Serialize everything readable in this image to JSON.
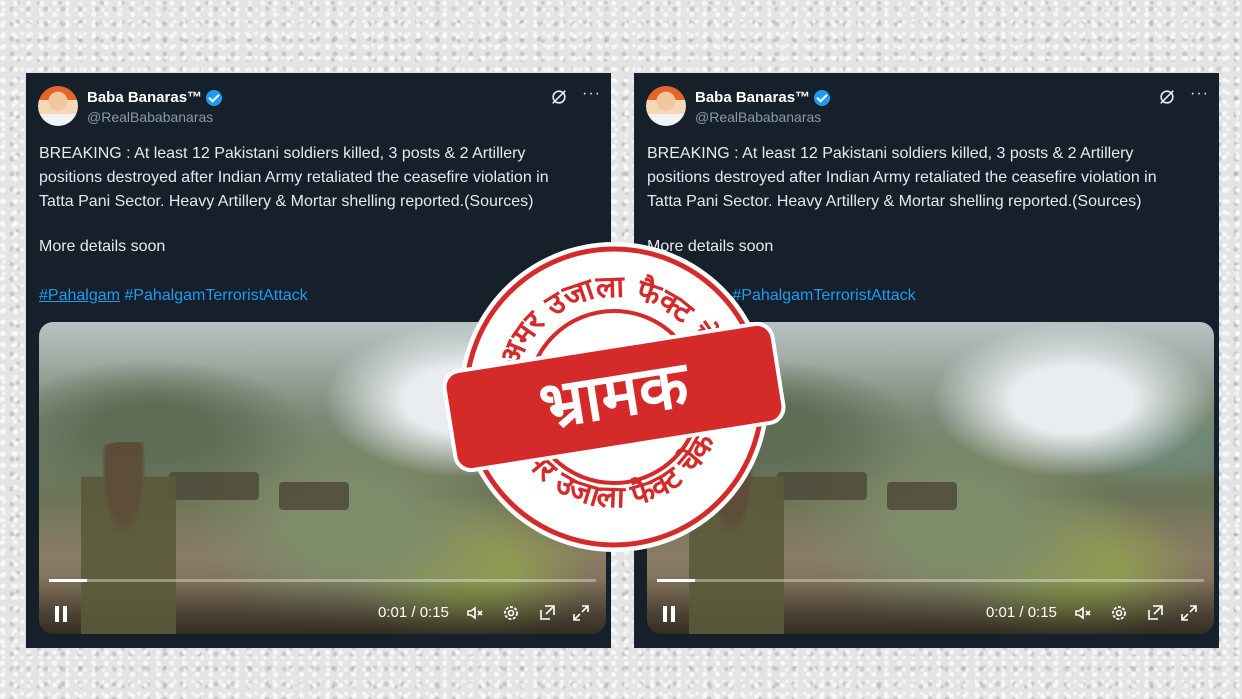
{
  "tweets": [
    {
      "author": "Baba Banaras™",
      "handle": "@RealBababanaras",
      "text": "BREAKING : At least 12 Pakistani soldiers killed, 3 posts & 2 Artillery\npositions destroyed after Indian Army retaliated the ceasefire violation in\nTatta Pani Sector. Heavy Artillery & Mortar shelling reported.(Sources)",
      "more": "More details soon",
      "hashtags": [
        "#Pahalgam",
        "#PahalgamTerroristAttack"
      ],
      "video": {
        "time": "0:01 / 0:15",
        "progress": 0.07
      }
    },
    {
      "author": "Baba Banaras™",
      "handle": "@RealBababanaras",
      "text": "BREAKING : At least 12 Pakistani soldiers killed, 3 posts & 2 Artillery\npositions destroyed after Indian Army retaliated the ceasefire violation in\nTatta Pani Sector. Heavy Artillery & Mortar shelling reported.(Sources)",
      "more": "More details soon",
      "hashtags": [
        "#Pahalgam",
        "#PahalgamTerroristAttack"
      ],
      "video": {
        "time": "0:01 / 0:15",
        "progress": 0.07
      }
    }
  ],
  "stamp": {
    "label": "भ्रामक",
    "ring_text_top": "अमर उजाला फैक्ट चेक",
    "ring_text_bottom": "अमर उजाला फैक्ट चेक",
    "color": "#d42a2a"
  },
  "icons": {
    "grok": "grok-icon",
    "more": "more-icon",
    "pause": "pause-icon",
    "mute": "mute-icon",
    "settings": "settings-icon",
    "pip": "pip-icon",
    "fullscreen": "fullscreen-icon"
  }
}
